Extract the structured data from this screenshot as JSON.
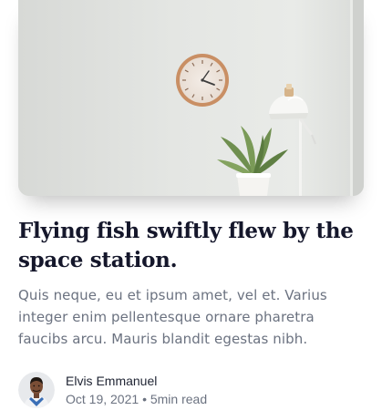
{
  "post": {
    "title": "Flying fish swiftly flew by the space station.",
    "excerpt": "Quis neque, eu et ipsum amet, vel et. Varius integer enim pellentesque ornare pharetra faucibs arcu. Mauris blandit egestas nibh.",
    "author": {
      "name": "Elvis Emmanuel"
    },
    "date": "Oct 19, 2021",
    "separator": "•",
    "read_time": "5min read"
  },
  "icons": [
    "wall-clock",
    "plant",
    "desk-lamp"
  ],
  "colors": {
    "title": "#15172b",
    "body_text": "#6b7280"
  }
}
